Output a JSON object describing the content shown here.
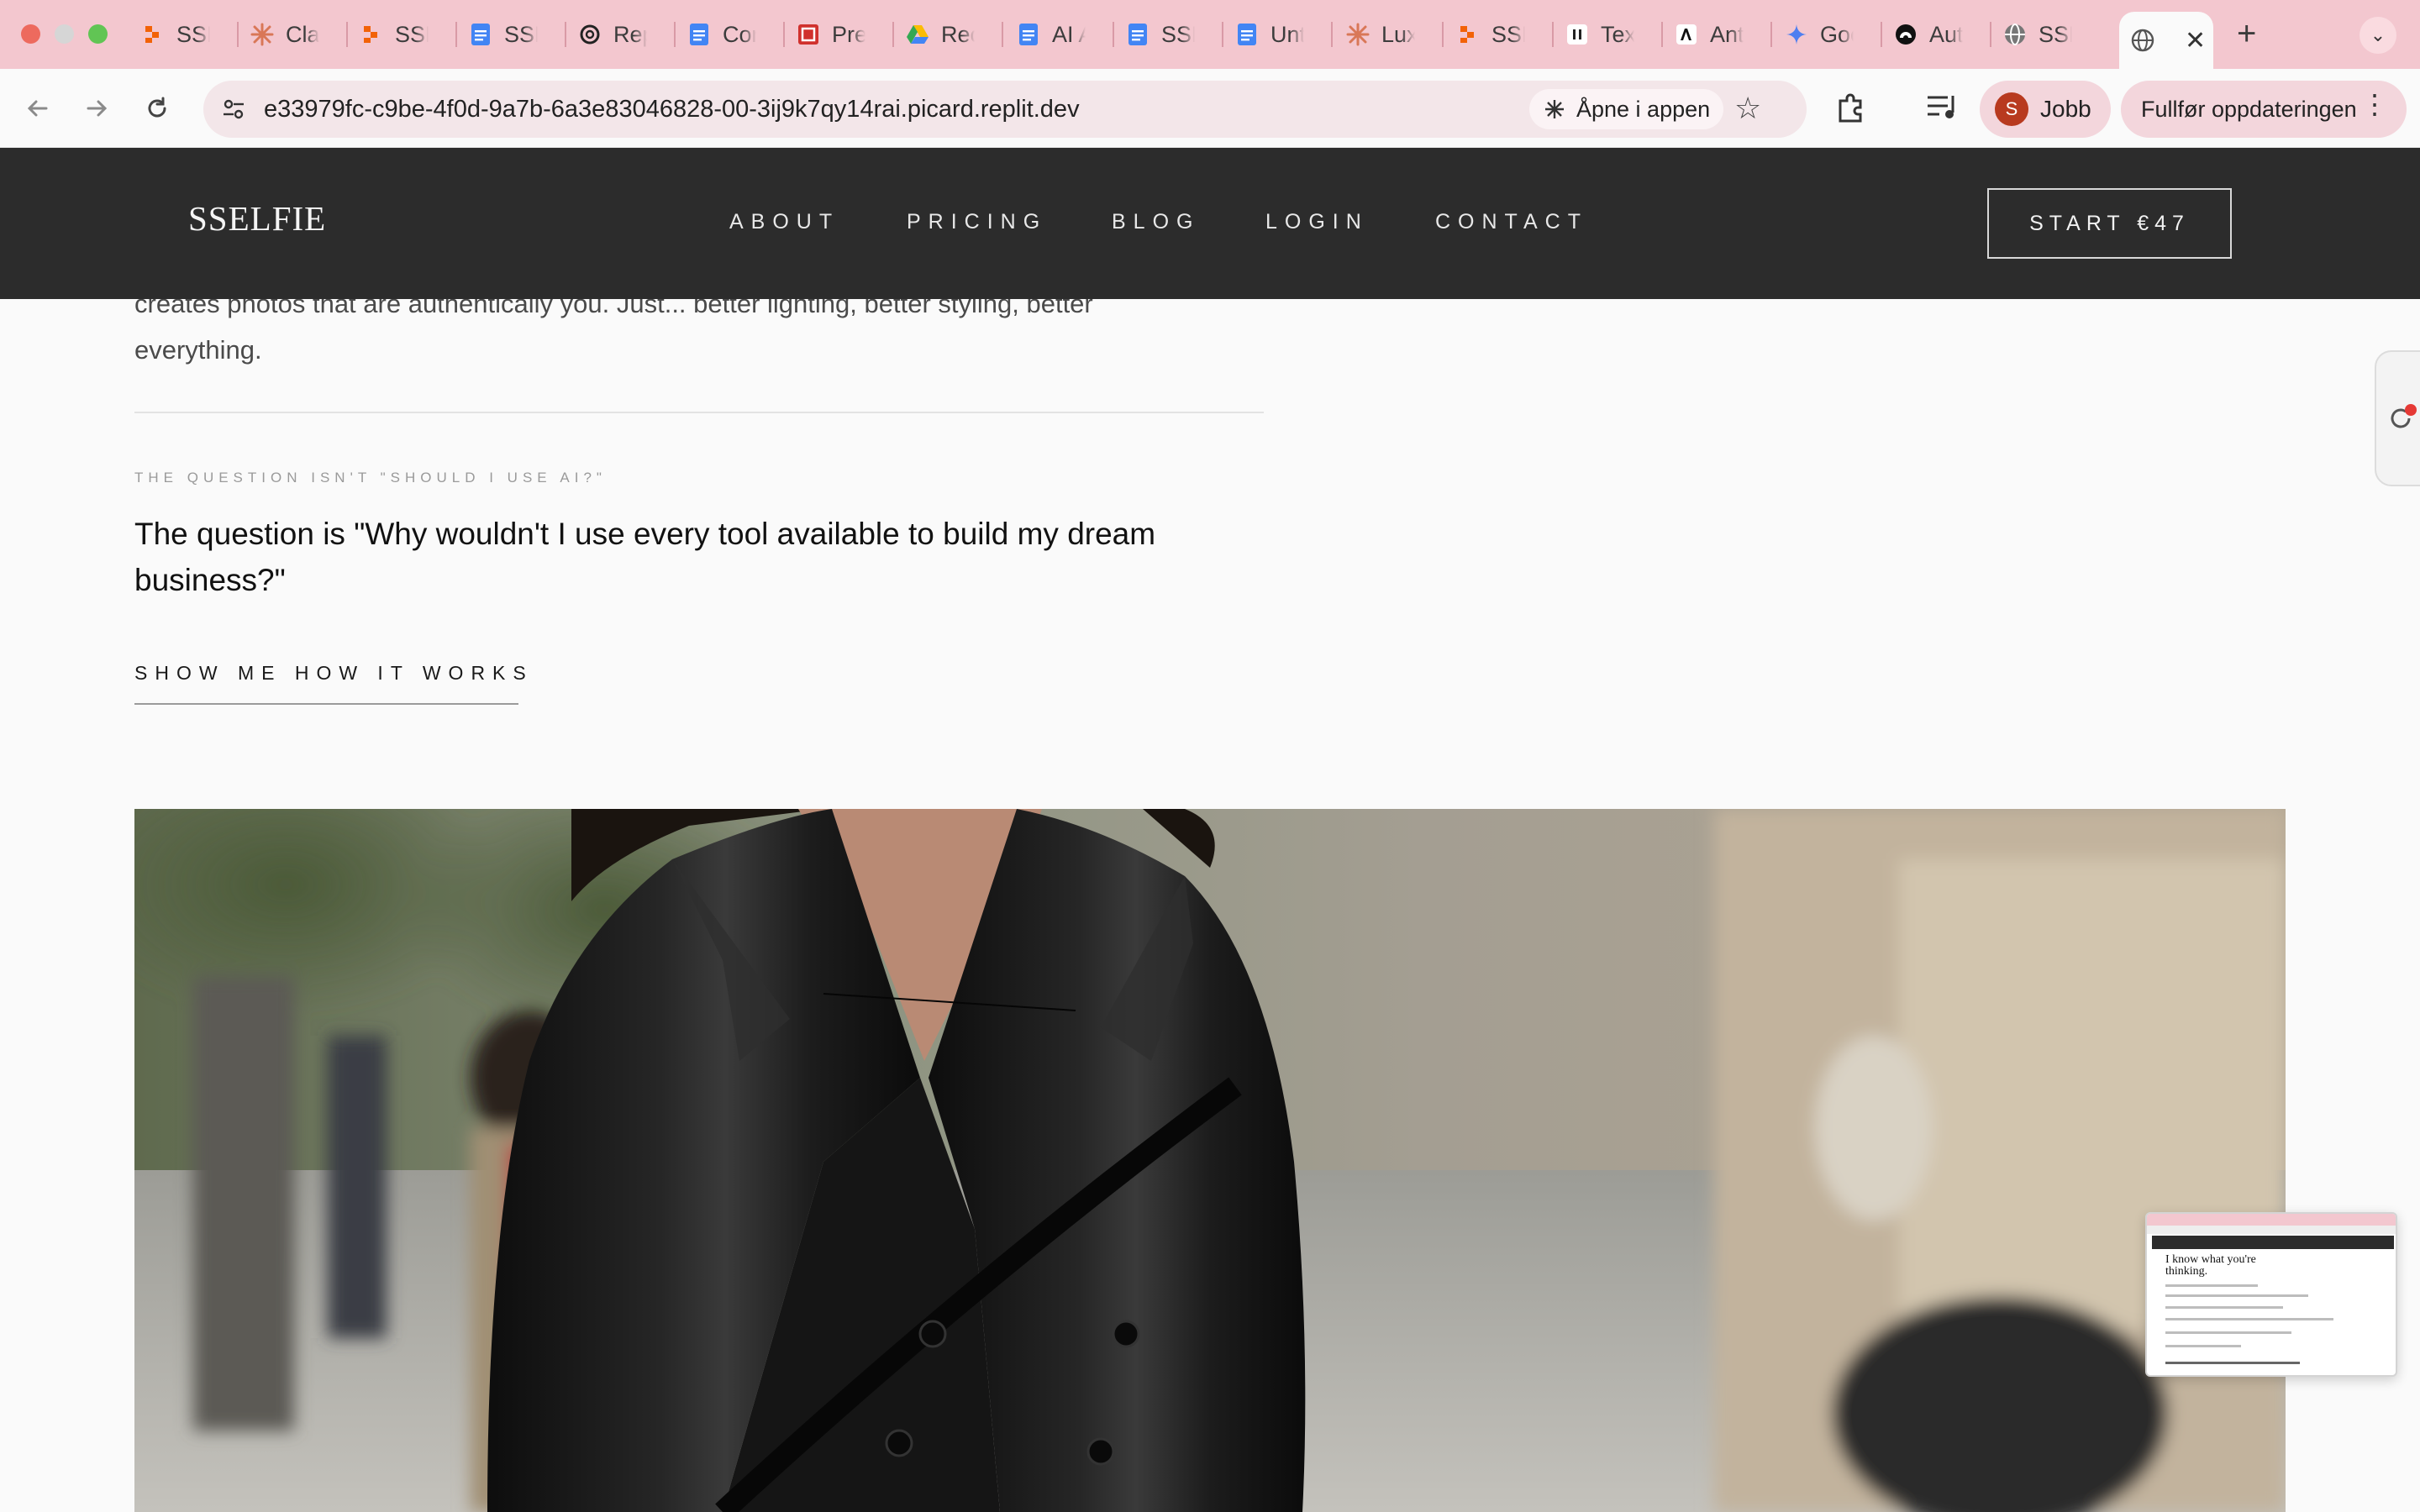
{
  "browser": {
    "tabs": [
      {
        "title": "SSE",
        "icon": "replit-icon"
      },
      {
        "title": "Cla",
        "icon": "claude-icon"
      },
      {
        "title": "SSE",
        "icon": "replit-icon"
      },
      {
        "title": "SSE",
        "icon": "google-docs-icon"
      },
      {
        "title": "Rep",
        "icon": "openai-icon"
      },
      {
        "title": "Cor",
        "icon": "google-docs-icon"
      },
      {
        "title": "Pre",
        "icon": "presentation-icon"
      },
      {
        "title": "Rec",
        "icon": "google-drive-icon"
      },
      {
        "title": "AI A",
        "icon": "google-docs-icon"
      },
      {
        "title": "SSE",
        "icon": "google-docs-icon"
      },
      {
        "title": "Unt",
        "icon": "google-docs-icon"
      },
      {
        "title": "Lux",
        "icon": "claude-icon"
      },
      {
        "title": "SSE",
        "icon": "replit-icon"
      },
      {
        "title": "Tex",
        "icon": "pause-icon"
      },
      {
        "title": "Ant",
        "icon": "anthropic-icon"
      },
      {
        "title": "Goo",
        "icon": "gemini-icon"
      },
      {
        "title": "Aut",
        "icon": "fingerprint-icon"
      },
      {
        "title": "SSE",
        "icon": "globe-icon"
      }
    ],
    "url": "e33979fc-c9be-4f0d-9a7b-6a3e83046828-00-3ij9k7qy14rai.picard.replit.dev",
    "open_in_app_label": "Åpne i appen",
    "profile_initial": "S",
    "profile_name": "Jobb",
    "update_label": "Fullfør oppdateringen"
  },
  "site": {
    "logo": "SSELFIE",
    "nav": [
      "ABOUT",
      "PRICING",
      "BLOG",
      "LOGIN",
      "CONTACT"
    ],
    "cta": "START €47"
  },
  "content": {
    "body_tail_line1": "creates photos that are authentically you. Just... better lighting, better styling, better",
    "body_tail_line2": "everything.",
    "eyebrow": "THE QUESTION ISN'T \"SHOULD I USE AI?\"",
    "question": "The question is \"Why wouldn't I use every tool available to build my dream business?\"",
    "show_link": "SHOW ME HOW IT WORKS"
  },
  "thumbnail": {
    "title": "I know what you're thinking."
  },
  "colors": {
    "tabstrip": "#f3c7cf",
    "header": "#2c2c2c",
    "page_bg": "#fafafa"
  }
}
